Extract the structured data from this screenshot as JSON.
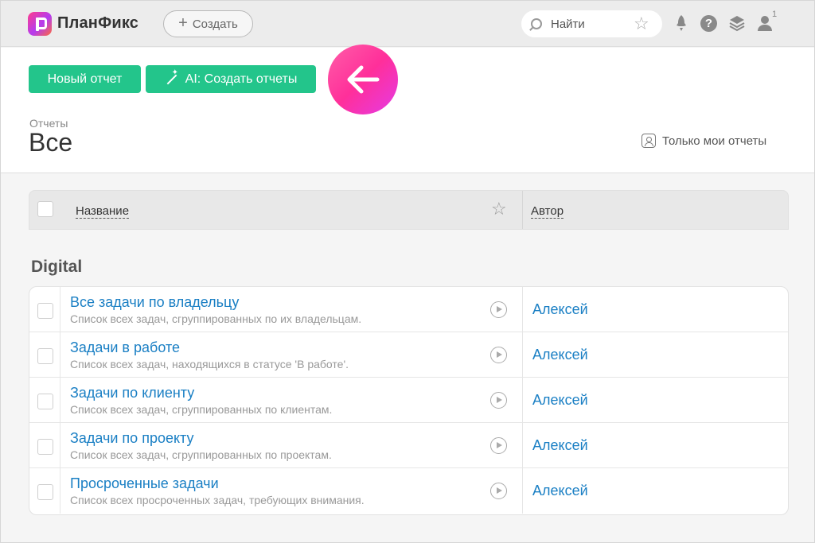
{
  "topbar": {
    "brand": "ПланФикс",
    "create_label": "Создать",
    "search_placeholder": "Найти",
    "user_badge": "1",
    "help_symbol": "?",
    "icons": [
      "rocket-icon",
      "help-icon",
      "layers-icon",
      "user-icon"
    ]
  },
  "header": {
    "new_report_label": "Новый отчет",
    "ai_report_label": "AI: Создать отчеты",
    "breadcrumb": "Отчеты",
    "title": "Все",
    "only_mine_label": "Только мои отчеты"
  },
  "table": {
    "col_name": "Название",
    "col_author": "Автор",
    "group": "Digital",
    "rows": [
      {
        "title": "Все задачи по владельцу",
        "desc": "Список всех задач, сгруппированных по их владельцам.",
        "author": "Алексей"
      },
      {
        "title": "Задачи в работе",
        "desc": "Список всех задач, находящихся в статусе 'В работе'.",
        "author": "Алексей"
      },
      {
        "title": "Задачи по клиенту",
        "desc": "Список всех задач, сгруппированных по клиентам.",
        "author": "Алексей"
      },
      {
        "title": "Задачи по проекту",
        "desc": "Список всех задач, сгруппированных по проектам.",
        "author": "Алексей"
      },
      {
        "title": "Просроченные задачи",
        "desc": "Список всех просроченных задач, требующих внимания.",
        "author": "Алексей"
      }
    ]
  },
  "colors": {
    "accent_green": "#23c58b",
    "link_blue": "#1a7fc4",
    "highlight_pink": "#ff2f9a"
  }
}
